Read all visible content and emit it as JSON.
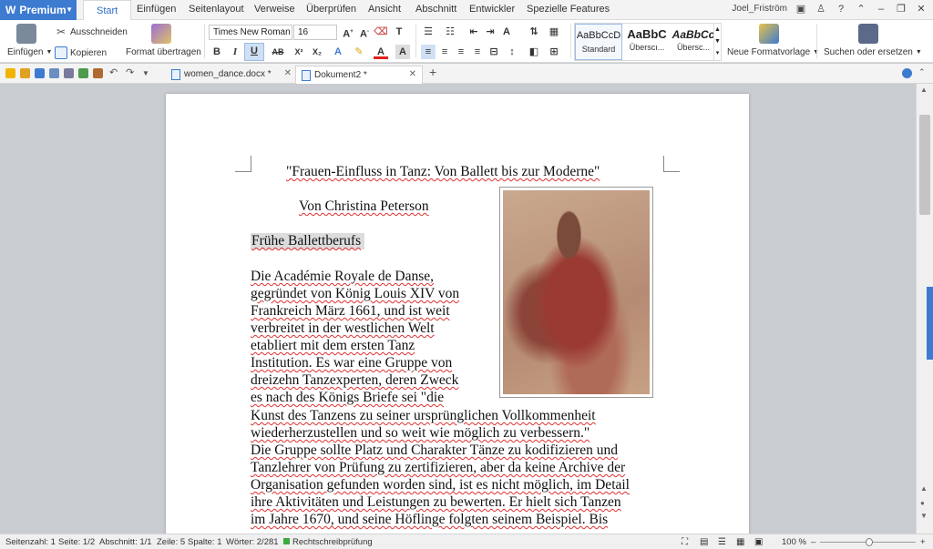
{
  "app": {
    "premium_label": "Premium",
    "user_name": "Joel_Friström"
  },
  "menu": {
    "tabs": [
      "Start",
      "Einfügen",
      "Seitenlayout",
      "Verweise",
      "Überprüfen",
      "Ansicht",
      "Abschnitt",
      "Entwickler",
      "Spezielle Features"
    ],
    "active": "Start"
  },
  "ribbon": {
    "paste_label": "Einfügen",
    "cut_label": "Ausschneiden",
    "copy_label": "Kopieren",
    "format_painter_label": "Format übertragen",
    "font_name": "Times New Roman",
    "font_size": "16",
    "styles": [
      {
        "preview": "AaBbCcD",
        "label": "Standard"
      },
      {
        "preview": "AaBbC",
        "label": "Überscı..."
      },
      {
        "preview": "AaBbCc",
        "label": "Übersc..."
      }
    ],
    "new_style_label": "Neue Formatvorlage",
    "find_replace_label": "Suchen oder ersetzen"
  },
  "doc_tabs": [
    {
      "name": "women_dance.docx *",
      "active": false
    },
    {
      "name": "Dokument2 *",
      "active": true
    }
  ],
  "document": {
    "title": "\"Frauen-Einfluss in Tanz: Von Ballett bis zur Moderne\"",
    "author": "Von Christina Peterson",
    "heading": "Frühe Ballettberufs",
    "lines": [
      "Die Académie Royale de Danse,",
      "gegründet von König Louis XIV von",
      "Frankreich März 1661, und ist weit",
      "verbreitet in der westlichen Welt",
      "etabliert mit dem ersten Tanz",
      "Institution. Es war eine Gruppe von",
      "dreizehn Tanzexperten, deren Zweck",
      "es nach des Königs Briefe sei \"die",
      "Kunst des Tanzens zu seiner ursprünglichen Vollkommenheit",
      "wiederherzustellen und so weit wie möglich zu verbessern.\"",
      "Die Gruppe sollte Platz und Charakter Tänze zu kodifizieren und",
      "Tanzlehrer von Prüfung zu zertifizieren, aber da keine Archive der",
      "Organisation gefunden worden sind, ist es nicht möglich, im Detail",
      "ihre Aktivitäten und Leistungen zu bewerten. Er hielt sich Tanzen",
      "im Jahre 1670, und seine Höflinge folgten seinem Beispiel. Bis"
    ]
  },
  "status": {
    "page_count": "Seitenzahl: 1",
    "page": "Seite: 1/2",
    "section": "Abschnitt: 1/1",
    "line": "Zeile: 5",
    "column": "Spalte: 1",
    "words": "Wörter: 2/281",
    "spellcheck": "Rechtschreibprüfung",
    "zoom": "100 %"
  }
}
